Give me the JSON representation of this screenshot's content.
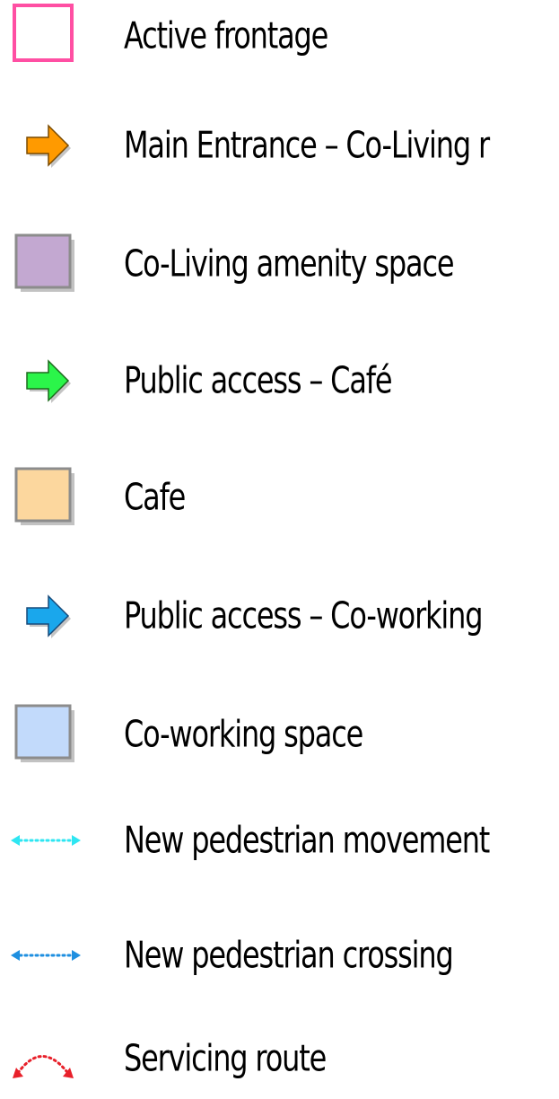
{
  "legend": {
    "items": [
      {
        "label": "Active frontage",
        "symbol": "outline-square",
        "color": "#ff4fa3"
      },
      {
        "label": "Main Entrance – Co-Living r",
        "symbol": "arrow-right",
        "color": "#ff9a00"
      },
      {
        "label": "Co-Living amenity space",
        "symbol": "filled-square",
        "color": "#c3a8d1"
      },
      {
        "label": "Public access – Café",
        "symbol": "arrow-right",
        "color": "#2bf54a"
      },
      {
        "label": "Cafe",
        "symbol": "filled-square",
        "color": "#fcd79e"
      },
      {
        "label": "Public access – Co-working",
        "symbol": "arrow-right",
        "color": "#1aa7ec"
      },
      {
        "label": "Co-working space",
        "symbol": "filled-square",
        "color": "#c2dafb"
      },
      {
        "label": "New pedestrian movement",
        "symbol": "dotted-double-arrow",
        "color": "#2ee6f2"
      },
      {
        "label": "New pedestrian crossing",
        "symbol": "dotted-double-arrow",
        "color": "#1e8fe0"
      },
      {
        "label": "Servicing route",
        "symbol": "dotted-arc-arrow",
        "color": "#e8202a"
      }
    ]
  }
}
